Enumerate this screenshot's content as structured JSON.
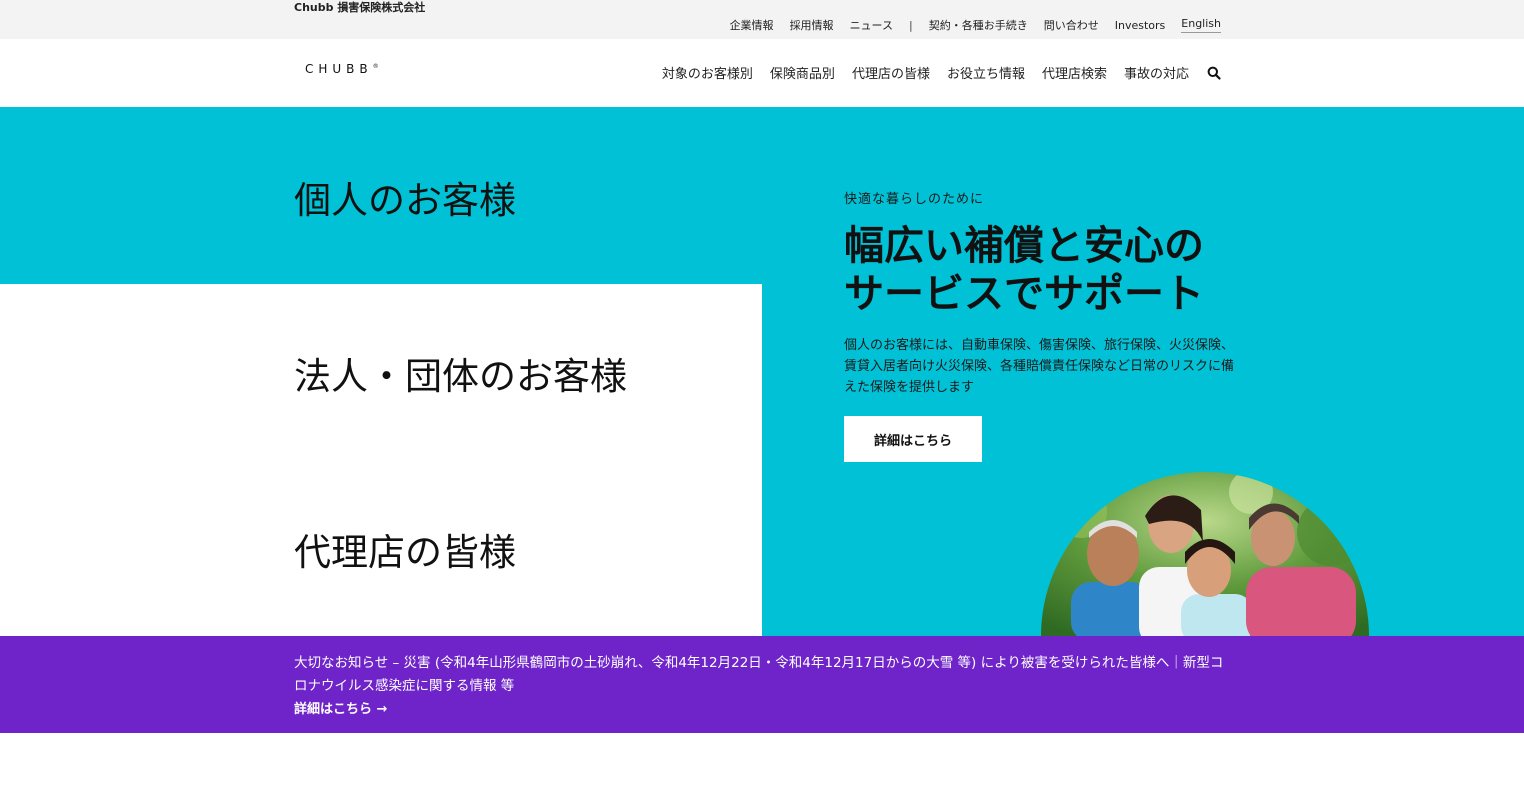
{
  "utility": {
    "company_name": "Chubb 損害保険株式会社",
    "links": [
      "企業情報",
      "採用情報",
      "ニュース",
      "契約・各種お手続き",
      "問い合わせ",
      "Investors"
    ],
    "separator": "|",
    "language": "English"
  },
  "header": {
    "logo": "CHUBB",
    "logo_mark": "®",
    "nav": [
      "対象のお客様別",
      "保険商品別",
      "代理店の皆様",
      "お役立ち情報",
      "代理店検索",
      "事故の対応"
    ],
    "search_icon": "search-icon"
  },
  "hero": {
    "segments": [
      "個人のお客様",
      "法人・団体のお客様",
      "代理店の皆様"
    ],
    "subheading": "快適な暮らしのために",
    "heading_line1": "幅広い補償と安心の",
    "heading_line2": "サービスでサポート",
    "description": "個人のお客様には、自動車保険、傷害保険、旅行保険、火災保険、賃貸入居者向け火災保険、各種賠償責任保険など日常のリスクに備えた保険を提供します",
    "button_label": "詳細はこちら"
  },
  "notice": {
    "text": "大切なお知らせ – 災害 (令和4年山形県鶴岡市の土砂崩れ、令和4年12月22日・令和4年12月17日からの大雪 等) により被害を受けられた皆様へ｜新型コロナウイルス感染症に関する情報 等",
    "link_label": "詳細はこちら →"
  },
  "colors": {
    "teal": "#00c1d5",
    "purple": "#6e24c8",
    "utility_bg": "#f3f3f3"
  }
}
